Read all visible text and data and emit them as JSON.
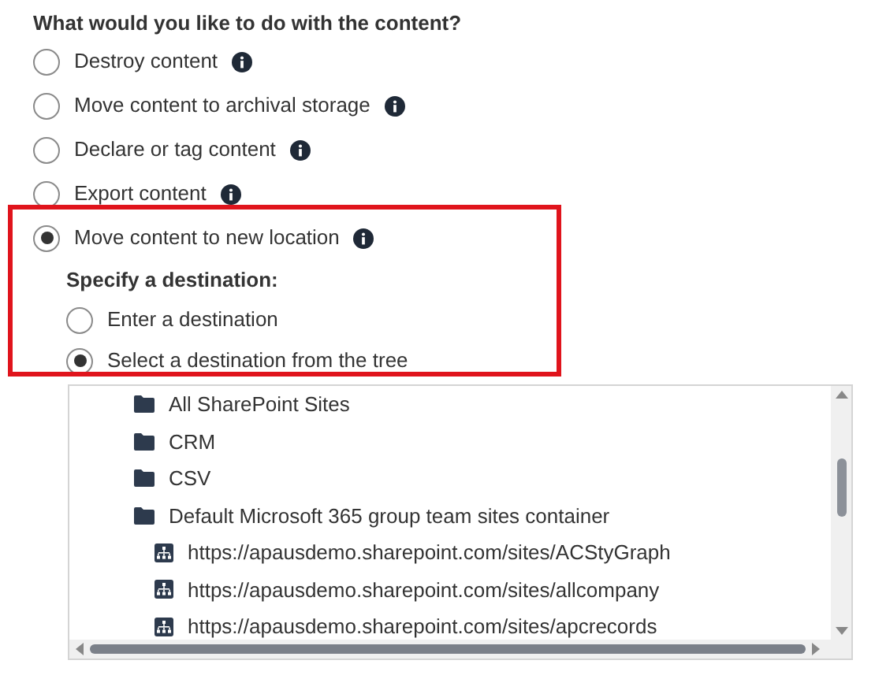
{
  "question": "What would you like to do with the content?",
  "options": [
    {
      "label": "Destroy content",
      "selected": false
    },
    {
      "label": "Move content to archival storage",
      "selected": false
    },
    {
      "label": "Declare or tag content",
      "selected": false
    },
    {
      "label": "Export content",
      "selected": false
    },
    {
      "label": "Move content to new location",
      "selected": true
    }
  ],
  "destination": {
    "heading": "Specify a destination:",
    "highlighted": true,
    "options": [
      {
        "label": "Enter a destination",
        "selected": false
      },
      {
        "label": "Select a destination from the tree",
        "selected": true
      }
    ]
  },
  "tree": {
    "items": [
      {
        "label": "All SharePoint Sites",
        "kind": "folder"
      },
      {
        "label": "CRM",
        "kind": "folder"
      },
      {
        "label": "CSV",
        "kind": "folder"
      },
      {
        "label": "Default Microsoft 365 group team sites container",
        "kind": "folder",
        "children": [
          {
            "label": "https://apausdemo.sharepoint.com/sites/ACStyGraph",
            "kind": "site"
          },
          {
            "label": "https://apausdemo.sharepoint.com/sites/allcompany",
            "kind": "site"
          },
          {
            "label": "https://apausdemo.sharepoint.com/sites/apcrecords",
            "kind": "site"
          }
        ]
      }
    ]
  }
}
